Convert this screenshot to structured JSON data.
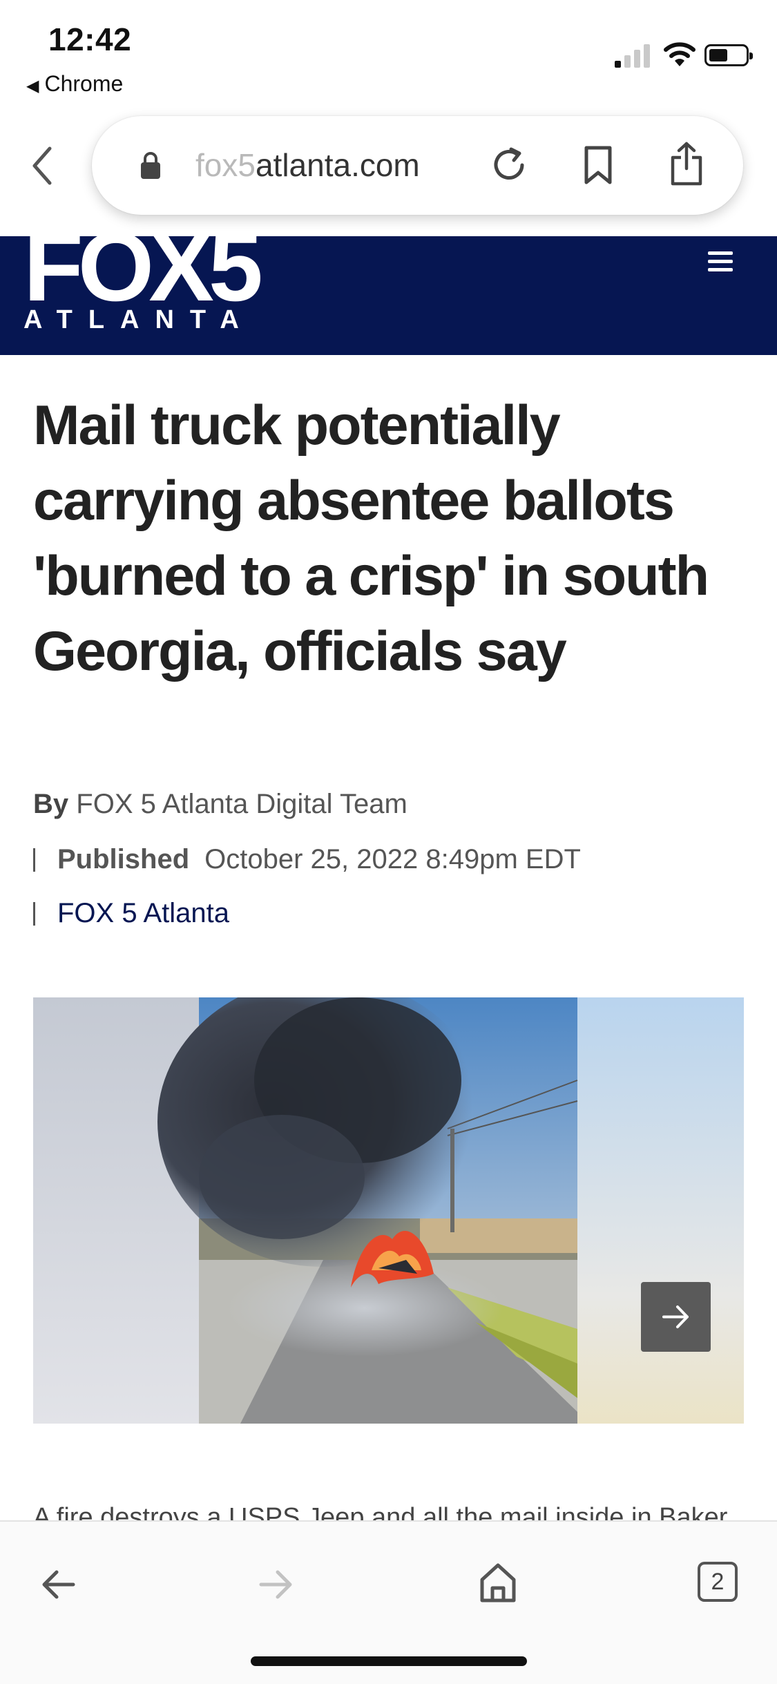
{
  "status_bar": {
    "time": "12:42",
    "back_app": "Chrome"
  },
  "browser": {
    "url_faded": "fox5",
    "url_main": "atlanta.com"
  },
  "site": {
    "logo_main": "FOX5",
    "logo_sub": "ATLANTA",
    "header_color": "#061652"
  },
  "article": {
    "headline": "Mail truck potentially carrying absentee ballots 'burned to a crisp' in south Georgia, officials say",
    "byline_prefix": "By",
    "byline_author": "FOX 5 Atlanta Digital Team",
    "published_label": "Published",
    "published_date": "October 25, 2022 8:49pm EDT",
    "source": "FOX 5 Atlanta",
    "caption": "A fire destroys a USPS Jeep and all the mail inside in Baker"
  },
  "toolbar": {
    "tab_count": "2"
  }
}
